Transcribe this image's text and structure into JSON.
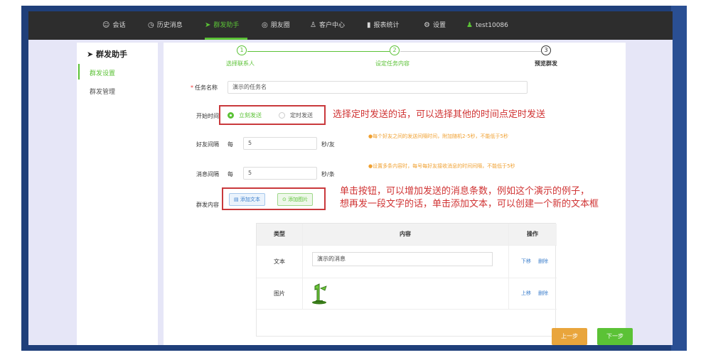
{
  "nav": {
    "items": [
      {
        "icon": "chat-icon",
        "label": "会话"
      },
      {
        "icon": "clock-icon",
        "label": "历史消息"
      },
      {
        "icon": "send-icon",
        "label": "群发助手"
      },
      {
        "icon": "moments-icon",
        "label": "朋友圈"
      },
      {
        "icon": "person-icon",
        "label": "客户中心"
      },
      {
        "icon": "chart-icon",
        "label": "报表统计"
      },
      {
        "icon": "gear-icon",
        "label": "设置"
      },
      {
        "icon": "user-icon",
        "label": "test10086"
      }
    ],
    "active": "群发助手",
    "accent": "#5bc236"
  },
  "sidebar": {
    "title": "群发助手",
    "items": [
      {
        "label": "群发设置",
        "active": true
      },
      {
        "label": "群发管理",
        "active": false
      }
    ]
  },
  "steps": [
    {
      "num": "1",
      "label": "选择联系人"
    },
    {
      "num": "2",
      "label": "设定任务内容"
    },
    {
      "num": "3",
      "label": "预览群发"
    }
  ],
  "form": {
    "task_name_label": "任务名称",
    "task_name_value": "演示的任务名",
    "start_time_label": "开始时间",
    "radio_now": "立刻发送",
    "radio_timed": "定时发送",
    "friend_interval_label": "好友间隔",
    "friend_interval_prefix": "每",
    "friend_interval_value": "5",
    "friend_interval_unit": "秒/友",
    "friend_interval_hint": "●每个好友之间的发送间隔时间，附加随机2-5秒，不能低于5秒",
    "msg_interval_label": "消息间隔",
    "msg_interval_prefix": "每",
    "msg_interval_value": "5",
    "msg_interval_unit": "秒/条",
    "msg_interval_hint": "●设置多条内容时，每号每好友接收消息的时间间隔，不能低于5秒",
    "content_label": "群发内容",
    "add_text_btn": "添加文本",
    "add_image_btn": "添加图片"
  },
  "table": {
    "headers": [
      "类型",
      "内容",
      "操作"
    ],
    "rows": [
      {
        "type": "文本",
        "content": "演示的消息",
        "ops": [
          "下移",
          "删除"
        ]
      },
      {
        "type": "图片",
        "content": "",
        "ops": [
          "上移",
          "删除"
        ]
      }
    ]
  },
  "buttons": {
    "prev": "上一步",
    "next": "下一步"
  },
  "annotations": {
    "timed": "选择定时发送的话，可以选择其他的时间点定时发送",
    "add_line1": "单击按钮，可以增加发送的消息条数，例如这个演示的例子，",
    "add_line2": "想再发一段文字的话，单击添加文本，可以创建一个新的文本框"
  }
}
